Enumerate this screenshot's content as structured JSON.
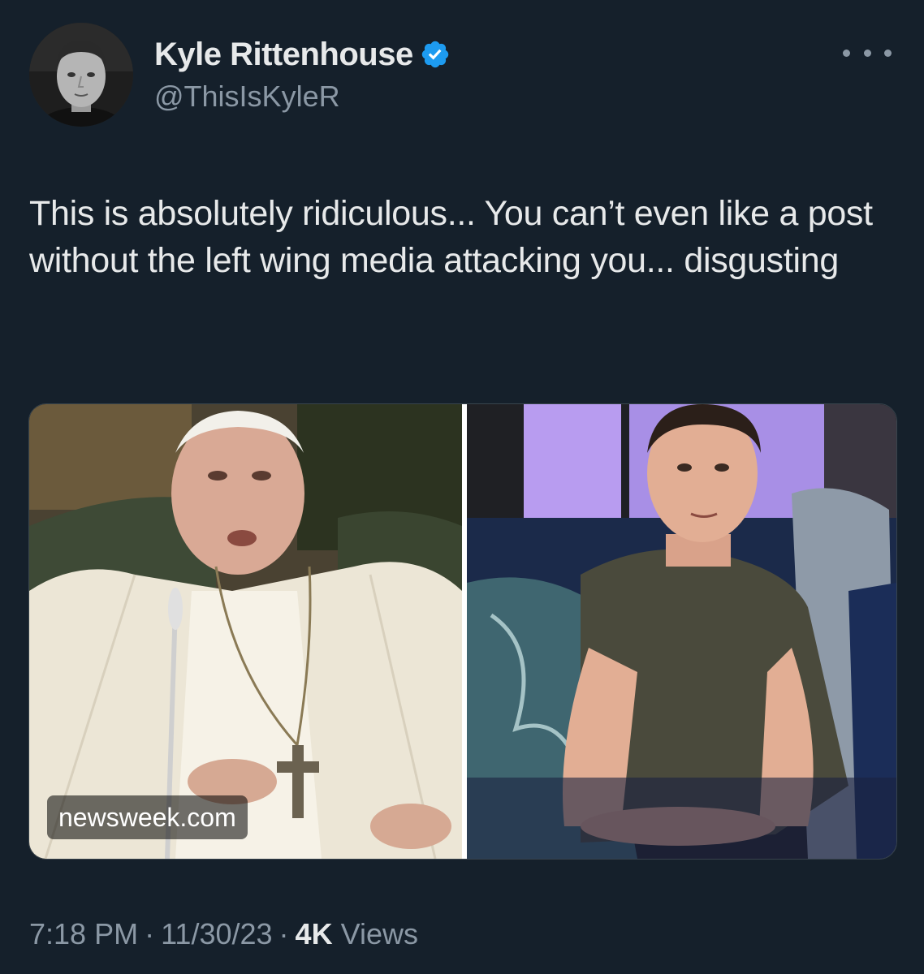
{
  "author": {
    "display_name": "Kyle Rittenhouse",
    "handle": "@ThisIsKyleR",
    "verified": true,
    "verified_color": "#1d9bf0"
  },
  "more_icon": "more-horizontal-icon",
  "tweet": {
    "text": "This is absolutely ridiculous... You can’t even like a post without the left wing media attacking you... disgusting"
  },
  "media": {
    "source_label": "newsweek.com"
  },
  "meta": {
    "time": "7:18 PM",
    "date": "11/30/23",
    "separator": "·",
    "views_count": "4K",
    "views_label": "Views"
  },
  "colors": {
    "background": "#15202b",
    "text_primary": "#e7e9ea",
    "text_secondary": "#8b98a5",
    "border": "#38444d"
  }
}
